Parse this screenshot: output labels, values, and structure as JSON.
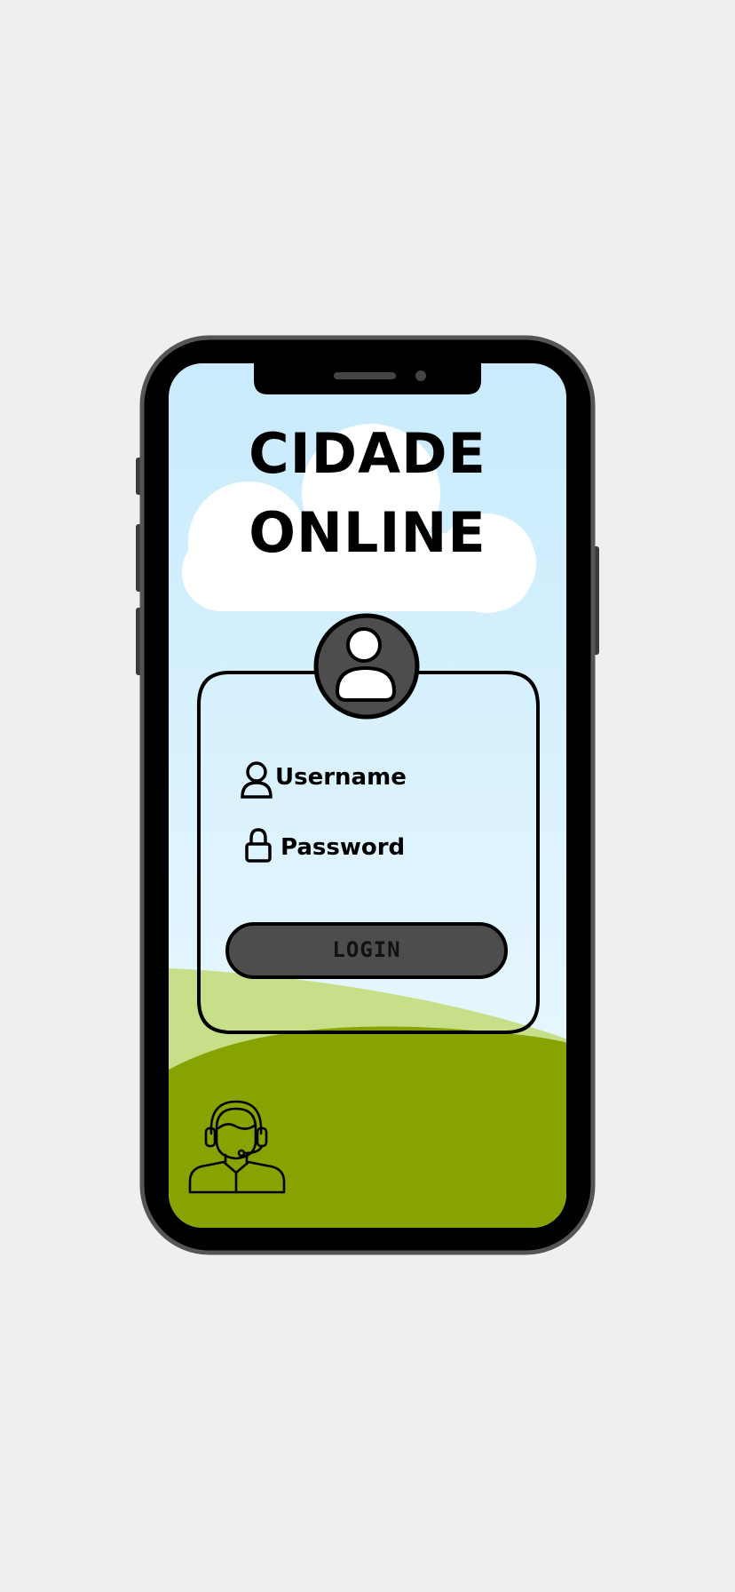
{
  "app": {
    "title_line1": "CIDADE",
    "title_line2": "ONLINE"
  },
  "login_form": {
    "username_label": "Username",
    "password_label": "Password",
    "login_button_label": "LOGIN"
  },
  "icons": {
    "avatar": "user-avatar-icon",
    "username": "user-icon",
    "password": "lock-icon",
    "support": "support-agent-headset-icon"
  },
  "colors": {
    "page_background": "#efefef",
    "phone_frame": "#000000",
    "phone_frame_edge": "#555555",
    "sky_top": "#c8ebfd",
    "sky_bottom": "#e9f7fd",
    "cloud": "#ffffff",
    "hill_light": "#c6df88",
    "hill_dark": "#86a300",
    "button_fill": "#4d4d4d",
    "avatar_fill": "#4d4d4d"
  }
}
